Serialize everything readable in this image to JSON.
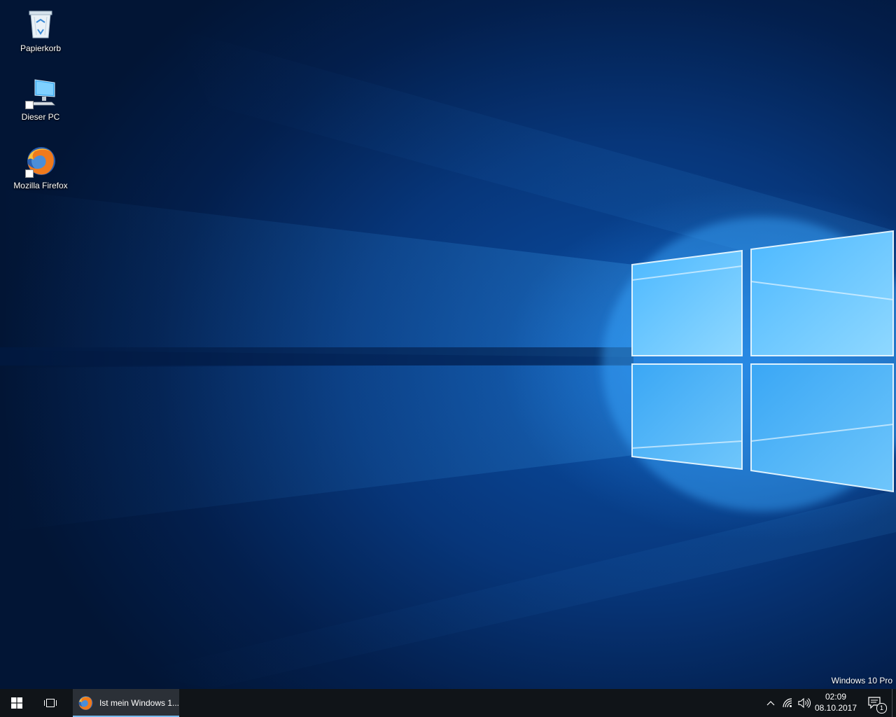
{
  "desktop": {
    "icons": [
      {
        "label": "Papierkorb",
        "icon": "recycle-bin-icon"
      },
      {
        "label": "Dieser PC",
        "icon": "computer-icon"
      },
      {
        "label": "Mozilla Firefox",
        "icon": "firefox-icon"
      }
    ],
    "watermark": "Windows 10 Pro"
  },
  "taskbar": {
    "start_icon": "windows-logo-icon",
    "task_view_icon": "task-view-icon",
    "running_app": {
      "label": "Ist mein Windows 1...",
      "icon": "firefox-icon"
    },
    "tray": {
      "chevron_icon": "chevron-up-icon",
      "network_icon": "network-icon",
      "volume_icon": "volume-icon"
    },
    "clock": {
      "time": "02:09",
      "date": "08.10.2017"
    },
    "action_center": {
      "icon": "notification-icon",
      "badge": "1"
    }
  },
  "colors": {
    "taskbar_bg": "#101418",
    "active_task_bg": "#2b3037",
    "active_underline": "#76b9ed",
    "wallpaper_light": "#5fc4ff",
    "wallpaper_dark": "#021535"
  }
}
